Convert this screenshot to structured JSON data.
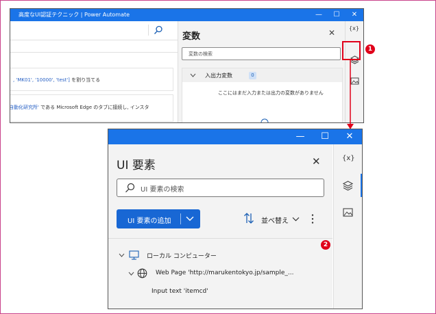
{
  "window_top": {
    "title": "高度なUI認証テクニック | Power Automate",
    "minimize": "—",
    "maximize": "☐",
    "close": "✕",
    "flow_steps": [
      {
        "prefix": "",
        "highlight": ", 'MK01', '10000', 'test']",
        "suffix": " を割り当てる"
      },
      {
        "prefix": "",
        "highlight": "自動化研究所'",
        "suffix": " である Microsoft Edge のタブに接続し, インスタ"
      }
    ],
    "variables_pane": {
      "title": "変数",
      "search_placeholder": "変数の検索",
      "io_section_label": "入出力変数",
      "io_count": "0",
      "empty_message": "ここにはまだ入力または出力の変数がありません"
    },
    "rail": {
      "variables_label": "{x}"
    }
  },
  "window_bottom": {
    "minimize": "—",
    "maximize": "☐",
    "close": "✕",
    "pane_title": "UI 要素",
    "search_placeholder": "UI 要素の検索",
    "add_button": "UI 要素の追加",
    "sort_label": "並べ替え",
    "tree": {
      "root": "ローカル コンピューター",
      "page": "Web Page 'http://marukentokyo.jp/sample_...",
      "element": "Input text 'itemcd'"
    },
    "rail": {
      "variables_label": "{x}"
    }
  },
  "callouts": {
    "one": "1",
    "two": "2"
  },
  "colors": {
    "titlebar": "#1a74e8",
    "accent": "#1867d4",
    "callout_red": "#e0001a",
    "frame": "#c8418a"
  }
}
